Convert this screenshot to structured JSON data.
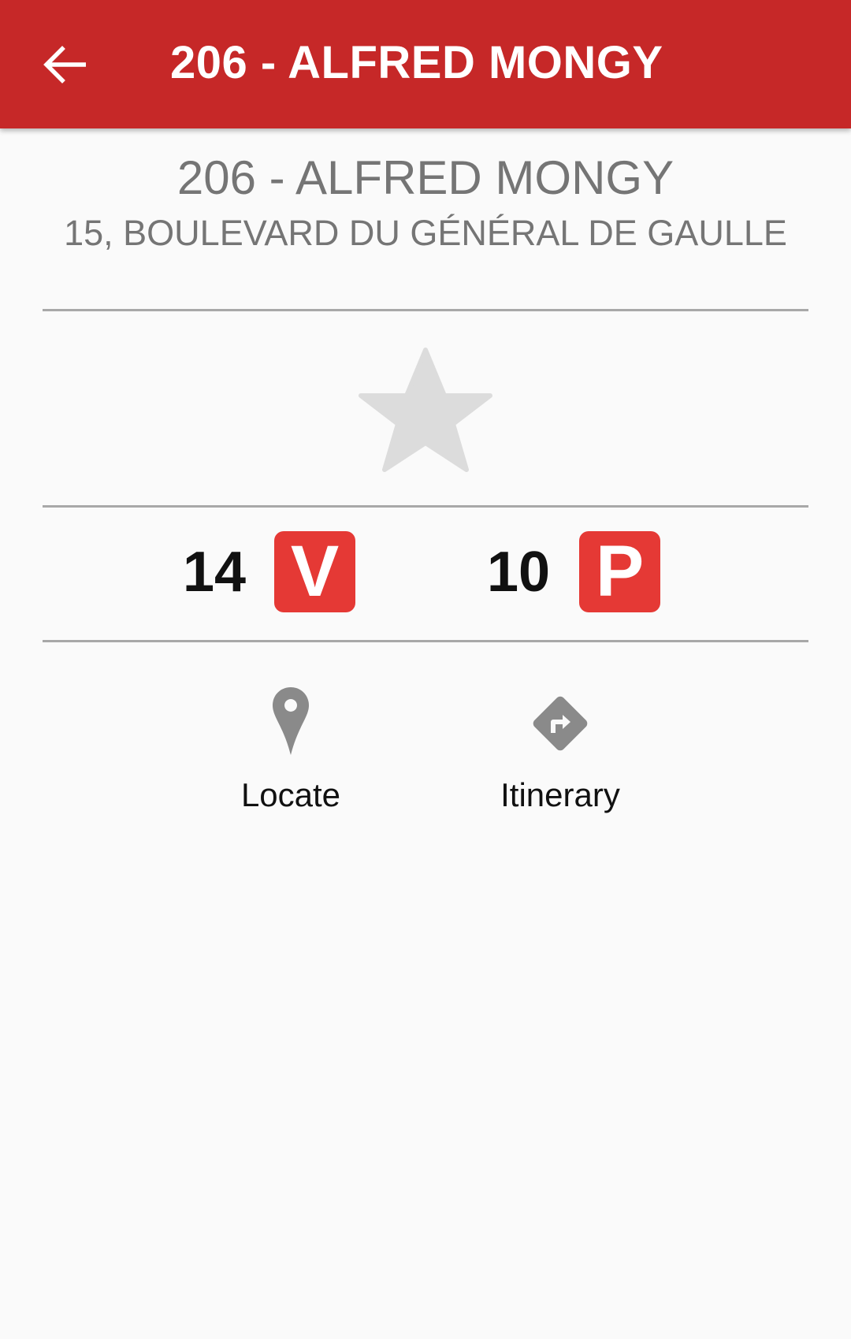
{
  "appbar": {
    "title": "206 - ALFRED MONGY",
    "back_icon": "arrow-left-icon"
  },
  "station": {
    "name": "206 - ALFRED MONGY",
    "address": "15, BOULEVARD DU GÉNÉRAL DE GAULLE"
  },
  "favorite": {
    "icon": "star-icon",
    "active": false,
    "color": "#dcdcdc"
  },
  "availability": {
    "bikes": {
      "count": "14",
      "badge": "V"
    },
    "parking": {
      "count": "10",
      "badge": "P"
    },
    "badge_color": "#e53935"
  },
  "actions": {
    "locate": {
      "label": "Locate",
      "icon": "map-pin-icon"
    },
    "itinerary": {
      "label": "Itinerary",
      "icon": "directions-icon"
    }
  },
  "colors": {
    "appbar": "#c62828",
    "background": "#fafafa",
    "secondary_text": "#757575",
    "icon_gray": "#8a8a8a"
  }
}
